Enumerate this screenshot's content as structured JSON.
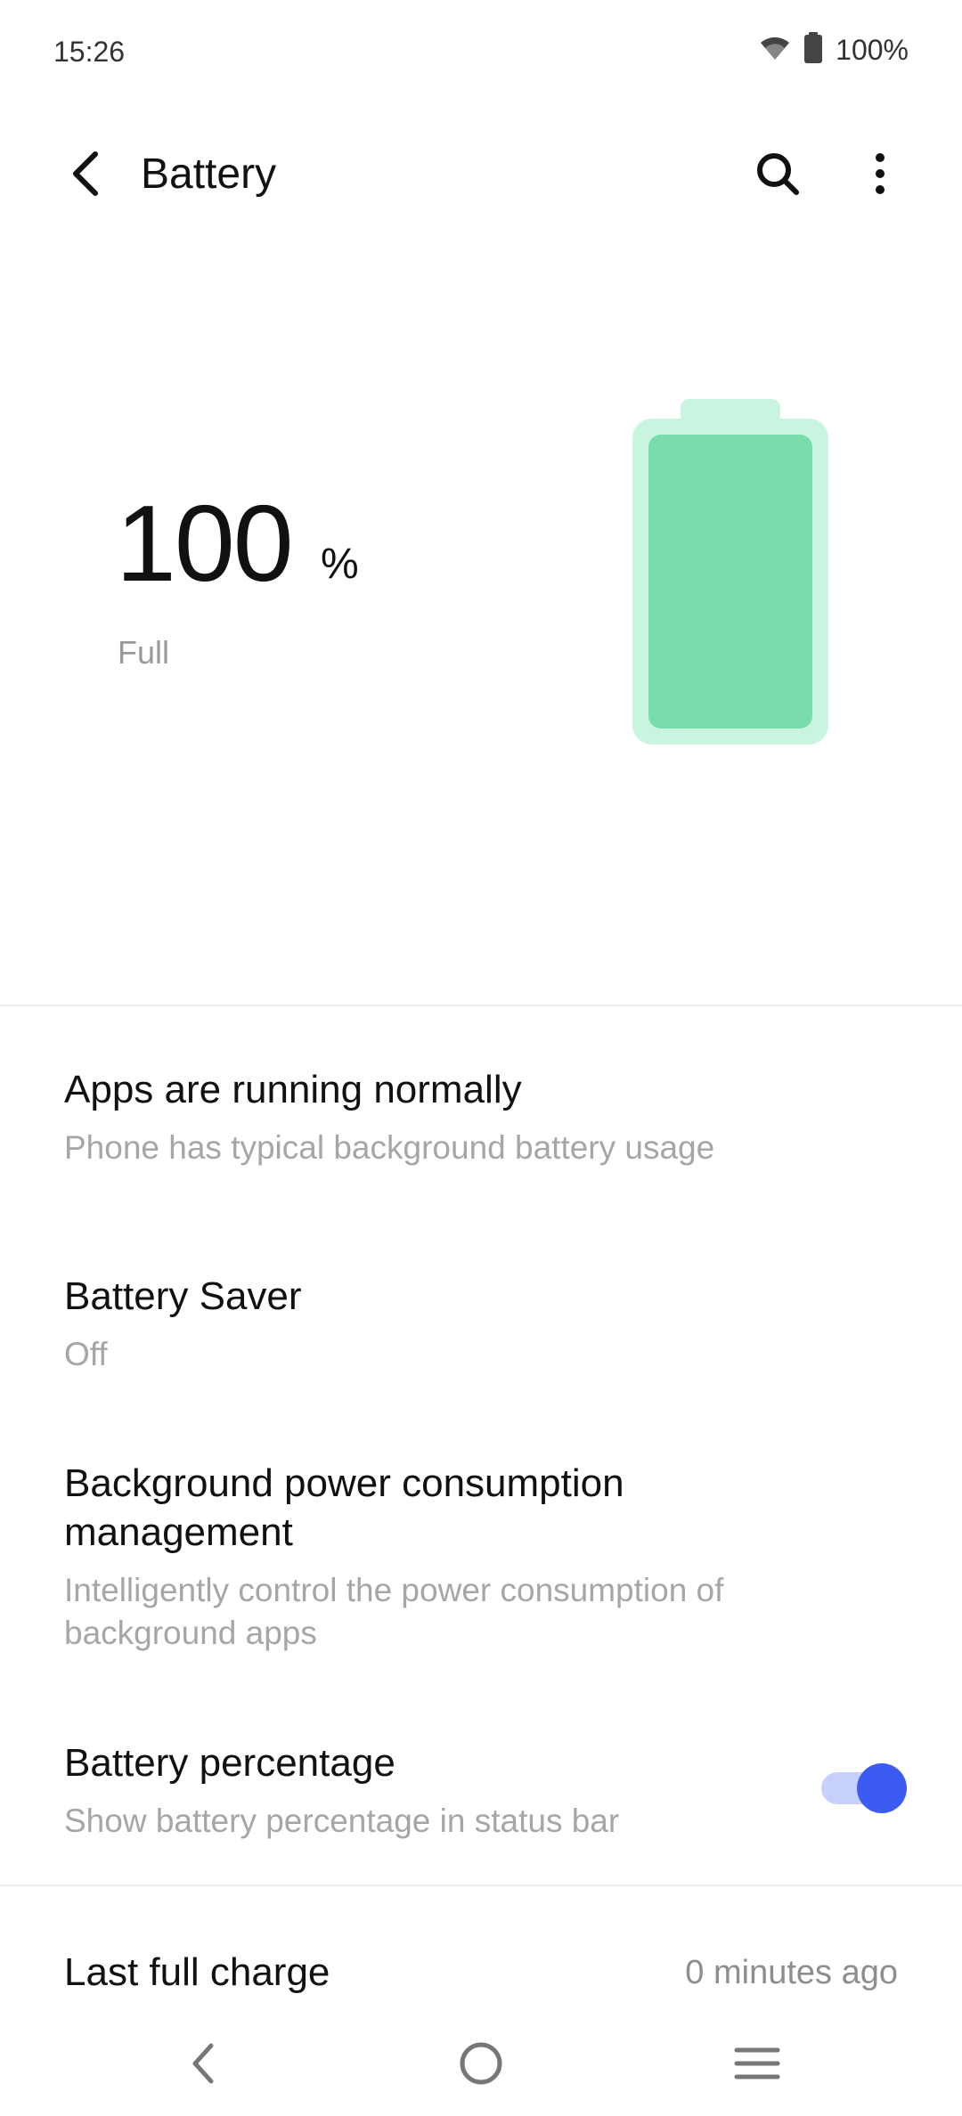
{
  "status_bar": {
    "time": "15:26",
    "battery_text": "100%",
    "icons": [
      "wifi-icon",
      "battery-icon"
    ]
  },
  "app_bar": {
    "title": "Battery",
    "icons": [
      "back-arrow-icon",
      "search-icon",
      "more-vert-icon"
    ]
  },
  "battery": {
    "percent_value": "100",
    "percent_unit": "%",
    "status": "Full",
    "level": 1.0,
    "colors": {
      "fill": "#78dcac",
      "outer": "#c9f5e0"
    }
  },
  "items": [
    {
      "title": "Apps are running normally",
      "subtitle": "Phone has typical background battery usage"
    },
    {
      "title": "Battery Saver",
      "subtitle": "Off"
    },
    {
      "title": "Background power consumption management",
      "subtitle": "Intelligently control the power consumption of background apps"
    },
    {
      "title": "Battery percentage",
      "subtitle": "Show battery percentage in status bar",
      "toggle_on": true
    }
  ],
  "last_full_charge": {
    "label": "Last full charge",
    "value": "0 minutes ago"
  },
  "nav_bar": {
    "icons": [
      "nav-back-icon",
      "nav-home-icon",
      "nav-recents-icon"
    ]
  },
  "accent_color": "#3c5bf0"
}
